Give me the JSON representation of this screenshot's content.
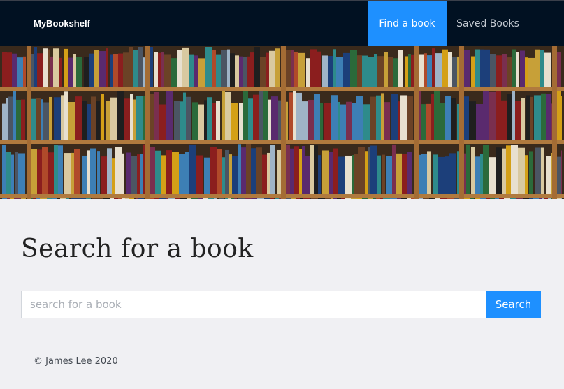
{
  "navbar": {
    "brand": "MyBookshelf",
    "links": [
      {
        "label": "Find a book",
        "active": true
      },
      {
        "label": "Saved Books",
        "active": false
      }
    ]
  },
  "hero": {
    "image": "bookshelf-photo"
  },
  "main": {
    "heading": "Search for a book",
    "search": {
      "placeholder": "search for a book",
      "value": "",
      "button_label": "Search"
    }
  },
  "footer": {
    "text": "© James Lee 2020"
  },
  "colors": {
    "navbar_bg": "#011122",
    "accent": "#1e90ff",
    "page_bg": "#f0f0f3"
  }
}
